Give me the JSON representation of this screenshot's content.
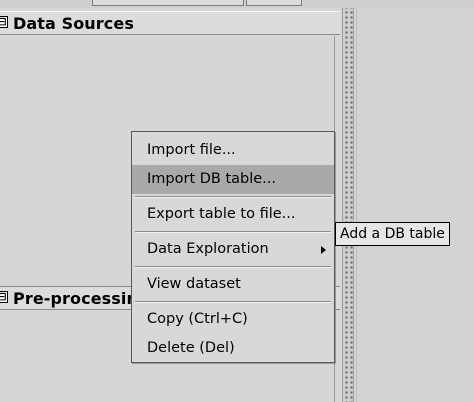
{
  "data_sources_panel": {
    "title": "Data Sources",
    "toggle_symbol": "⊟"
  },
  "preprocessing_panel": {
    "title": "Pre-processing",
    "toggle_symbol": "⊟"
  },
  "context_menu": {
    "items": [
      {
        "label": "Import file..."
      },
      {
        "label": "Import DB table..."
      },
      {
        "label": "Export table to file..."
      },
      {
        "label": "Data Exploration",
        "submenu": true
      },
      {
        "label": "View dataset"
      },
      {
        "label": "Copy (Ctrl+C)"
      },
      {
        "label": "Delete (Del)"
      }
    ],
    "highlighted_item": "Import DB table..."
  },
  "tooltip": {
    "text": "Add a DB table"
  },
  "colors": {
    "background": "#d6d6d6",
    "menu_highlight": "#a9a9a9",
    "tooltip_bg": "#e6e6e6"
  }
}
